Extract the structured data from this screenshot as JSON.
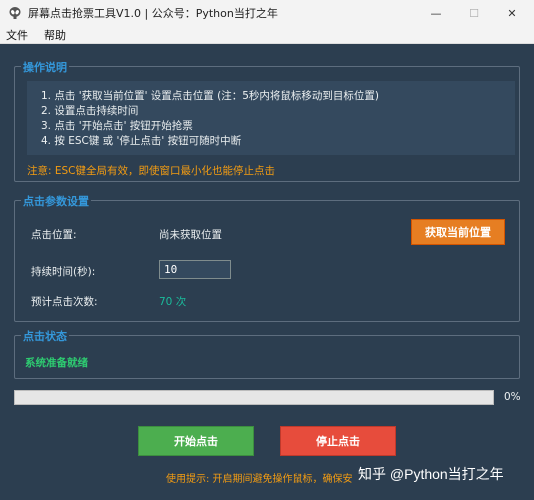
{
  "window": {
    "title": "屏幕点击抢票工具V1.0 | 公众号：Python当打之年",
    "min_glyph": "—",
    "max_glyph": "☐",
    "close_glyph": "✕"
  },
  "menu": [
    "文件",
    "帮助"
  ],
  "instructions_group": {
    "title": "操作说明",
    "lines": [
      "1. 点击 '获取当前位置' 设置点击位置 (注：5秒内将鼠标移动到目标位置)",
      "2. 设置点击持续时间",
      "3. 点击 '开始点击' 按钮开始抢票",
      "4. 按 ESC键 或 '停止点击' 按钮可随时中断"
    ],
    "note": "注意: ESC键全局有效，即使窗口最小化也能停止点击"
  },
  "params_group": {
    "title": "点击参数设置",
    "position_label": "点击位置:",
    "position_value": "尚未获取位置",
    "get_position_button": "获取当前位置",
    "duration_label": "持续时间(秒):",
    "duration_value": "10",
    "estimate_label": "预计点击次数:",
    "estimate_value": "70 次"
  },
  "status_group": {
    "title": "点击状态",
    "status": "系统准备就绪"
  },
  "progress": {
    "value": 0,
    "label": "0%"
  },
  "buttons": {
    "start": "开始点击",
    "stop": "停止点击"
  },
  "tip": "使用提示: 开启期间避免操作鼠标，确保安",
  "watermark": "知乎 @Python当打之年",
  "colors": {
    "background": "#2c3e50",
    "accent": "#3498db",
    "orange": "#e67e22",
    "green": "#4cae4f",
    "red": "#e74c3c",
    "note": "#f39c12"
  }
}
